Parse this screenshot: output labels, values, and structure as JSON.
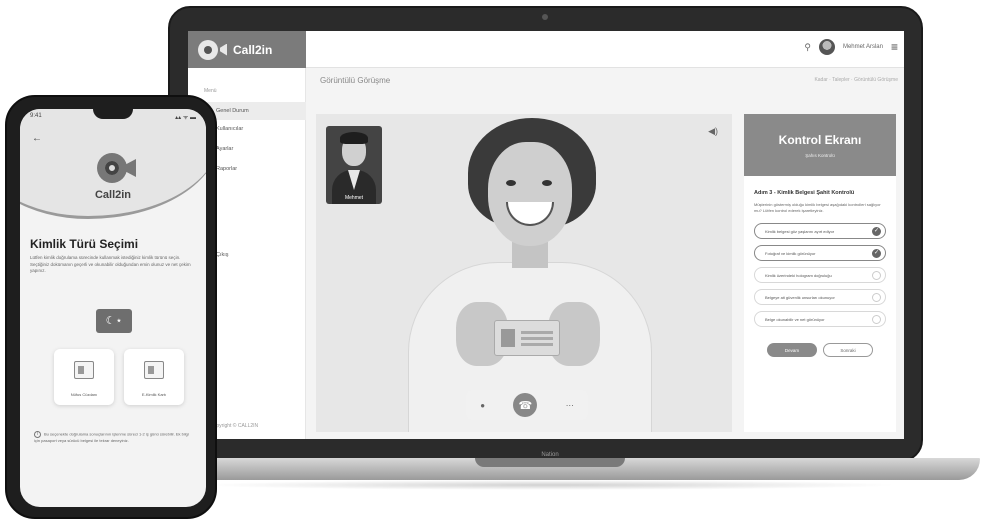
{
  "laptop": {
    "brand": "Nation",
    "app": {
      "logo_text": "Call2in",
      "user_name": "Mehmet Arslan",
      "page_title": "Görüntülü Görüşme",
      "breadcrumb": "Kadar · Talepler · Görüntülü Görüşme",
      "sidebar": {
        "heading": "Menü",
        "items": [
          {
            "label": "Genel Durum"
          },
          {
            "label": "Kullanıcılar"
          },
          {
            "label": "Ayarlar"
          },
          {
            "label": "Raporlar"
          },
          {
            "label": "Çıkış"
          }
        ],
        "footer": "Copyright © CALL2IN"
      },
      "video": {
        "pip_name": "Mehmet"
      },
      "control_panel": {
        "title": "Kontrol Ekranı",
        "subtitle": "Şahıs Kontrolü",
        "question": "Adım 3 - Kimlik Belgesi Şahit Kontrolü",
        "description": "Müşterinin göstermiş olduğu kimlik belgesi aşağıdaki kontrolleri sağlıyor mu? Lütfen kontrol ederek işaretleyiniz.",
        "checks": [
          {
            "label": "Kimlik belgesi göz yaşlarını ayırt ediyor",
            "checked": true
          },
          {
            "label": "Fotoğraf ve kimlik görünüyor",
            "checked": true
          },
          {
            "label": "Kimlik üzerindeki hologram doğruluğu",
            "checked": false
          },
          {
            "label": "Belgeye ait güvenlik unsurları okunuyor",
            "checked": false
          },
          {
            "label": "Belge okunabilir ve net görünüyor",
            "checked": false
          }
        ],
        "primary_button": "Devam",
        "secondary_button": "Sonraki"
      }
    }
  },
  "phone": {
    "time": "9:41",
    "signal": "▴▴ ᯤ ▬",
    "app_name": "Call2in",
    "title": "Kimlik Türü Seçimi",
    "description": "Lütfen kimlik doğrulama sürecinde kullanmak istediğiniz kimlik türünü seçin. Seçtiğiniz dokümanın geçerli ve okunabilir olduğundan emin olunuz ve net çekim yapınız.",
    "flag_symbol": "☾⋆",
    "documents": [
      {
        "label": "Nüfus Cüzdanı"
      },
      {
        "label": "E-Kimlik Kartı"
      }
    ],
    "info": "Bu seçenekte doğrulama sonuçlarının işlenme süreci 1-2 iş günü sürebilir. Ek bilgi için pasaport veya sürücü belgesi ile tekrar deneyiniz."
  },
  "colors": {
    "accent": "#8a8a8a",
    "header_dark": "#7b7b7b"
  }
}
